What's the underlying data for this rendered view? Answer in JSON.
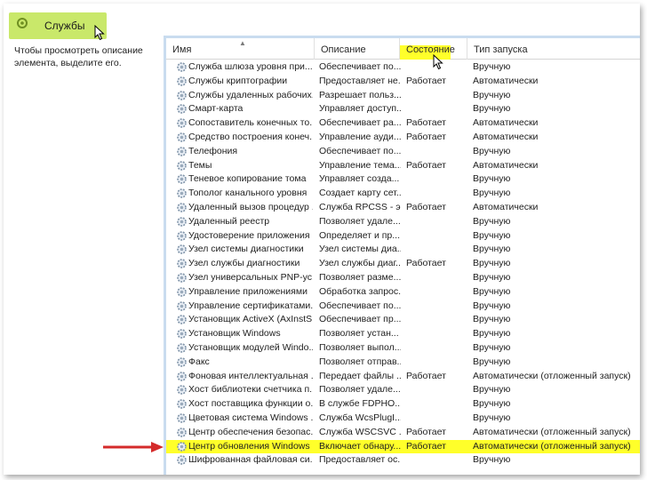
{
  "window": {
    "title": "Службы"
  },
  "description_pane": {
    "text": "Чтобы просмотреть описание элемента, выделите его."
  },
  "columns": {
    "name": "Имя",
    "description": "Описание",
    "state": "Состояние",
    "startup": "Тип запуска"
  },
  "colors": {
    "title_tab": "#c9e86a",
    "highlight": "#ffff2a",
    "pane_border": "#c9dcef",
    "annotation_red": "#d42b2b"
  },
  "services": [
    {
      "name": "Служба шлюза уровня при...",
      "description": "Обеспечивает по...",
      "state": "",
      "startup": "Вручную"
    },
    {
      "name": "Службы криптографии",
      "description": "Предоставляет не...",
      "state": "Работает",
      "startup": "Автоматически"
    },
    {
      "name": "Службы удаленных рабочих...",
      "description": "Разрешает польз...",
      "state": "",
      "startup": "Вручную"
    },
    {
      "name": "Смарт-карта",
      "description": "Управляет доступ...",
      "state": "",
      "startup": "Вручную"
    },
    {
      "name": "Сопоставитель конечных то...",
      "description": "Обеспечивает ра...",
      "state": "Работает",
      "startup": "Автоматически"
    },
    {
      "name": "Средство построения конеч...",
      "description": "Управление ауди...",
      "state": "Работает",
      "startup": "Автоматически"
    },
    {
      "name": "Телефония",
      "description": "Обеспечивает по...",
      "state": "",
      "startup": "Вручную"
    },
    {
      "name": "Темы",
      "description": "Управление тема...",
      "state": "Работает",
      "startup": "Автоматически"
    },
    {
      "name": "Теневое копирование тома",
      "description": "Управляет созда...",
      "state": "",
      "startup": "Вручную"
    },
    {
      "name": "Тополог канального уровня",
      "description": "Создает карту сет...",
      "state": "",
      "startup": "Вручную"
    },
    {
      "name": "Удаленный вызов процедур ...",
      "description": "Служба RPCSS - э...",
      "state": "Работает",
      "startup": "Автоматически"
    },
    {
      "name": "Удаленный реестр",
      "description": "Позволяет удале...",
      "state": "",
      "startup": "Вручную"
    },
    {
      "name": "Удостоверение приложения",
      "description": "Определяет и пр...",
      "state": "",
      "startup": "Вручную"
    },
    {
      "name": "Узел системы диагностики",
      "description": "Узел системы диа...",
      "state": "",
      "startup": "Вручную"
    },
    {
      "name": "Узел службы диагностики",
      "description": "Узел службы диаг...",
      "state": "Работает",
      "startup": "Вручную"
    },
    {
      "name": "Узел универсальных PNP-ус...",
      "description": "Позволяет разме...",
      "state": "",
      "startup": "Вручную"
    },
    {
      "name": "Управление приложениями",
      "description": "Обработка запрос...",
      "state": "",
      "startup": "Вручную"
    },
    {
      "name": "Управление сертификатами...",
      "description": "Обеспечивает по...",
      "state": "",
      "startup": "Вручную"
    },
    {
      "name": "Установщик ActiveX (AxInstS...",
      "description": "Обеспечивает пр...",
      "state": "",
      "startup": "Вручную"
    },
    {
      "name": "Установщик Windows",
      "description": "Позволяет устан...",
      "state": "",
      "startup": "Вручную"
    },
    {
      "name": "Установщик модулей Windo...",
      "description": "Позволяет выпол...",
      "state": "",
      "startup": "Вручную"
    },
    {
      "name": "Факс",
      "description": "Позволяет отправ...",
      "state": "",
      "startup": "Вручную"
    },
    {
      "name": "Фоновая интеллектуальная ...",
      "description": "Передает файлы ...",
      "state": "Работает",
      "startup": "Автоматически (отложенный запуск)"
    },
    {
      "name": "Хост библиотеки счетчика п...",
      "description": "Позволяет удале...",
      "state": "",
      "startup": "Вручную"
    },
    {
      "name": "Хост поставщика функции о...",
      "description": "В службе FDPHO...",
      "state": "",
      "startup": "Вручную"
    },
    {
      "name": "Цветовая система Windows ...",
      "description": "Служба WcsPlugI...",
      "state": "",
      "startup": "Вручную"
    },
    {
      "name": "Центр обеспечения безопас...",
      "description": "Служба WSCSVC ...",
      "state": "Работает",
      "startup": "Автоматически (отложенный запуск)"
    },
    {
      "name": "Центр обновления Windows",
      "description": "Включает обнару...",
      "state": "Работает",
      "startup": "Автоматически (отложенный запуск)",
      "highlighted": true
    },
    {
      "name": "Шифрованная файловая си...",
      "description": "Предоставляет ос...",
      "state": "",
      "startup": "Вручную"
    }
  ]
}
